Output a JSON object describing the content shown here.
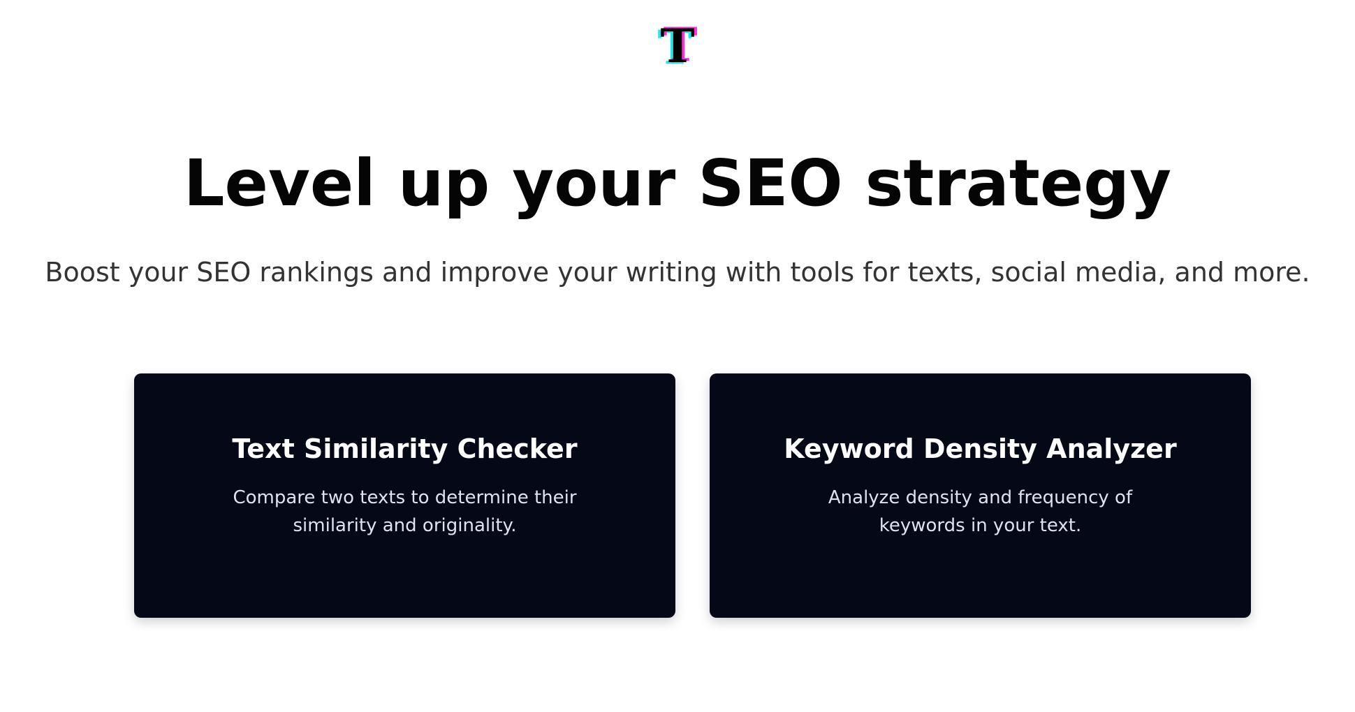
{
  "logo": {
    "letter": "T",
    "colors": {
      "main": "#000000",
      "cyan": "#23e4e6",
      "pink": "#ff2fd6"
    }
  },
  "hero": {
    "title": "Level up your SEO strategy",
    "subtitle": "Boost your SEO rankings and improve your writing with tools for texts, social media, and more."
  },
  "cards": [
    {
      "title": "Text Similarity Checker",
      "description": "Compare two texts to determine their similarity and originality."
    },
    {
      "title": "Keyword Density Analyzer",
      "description": "Analyze density and frequency of keywords in your text."
    }
  ],
  "colors": {
    "card_background": "#050816",
    "card_title": "#ffffff",
    "card_text": "#dde3f0",
    "page_background": "#ffffff"
  }
}
